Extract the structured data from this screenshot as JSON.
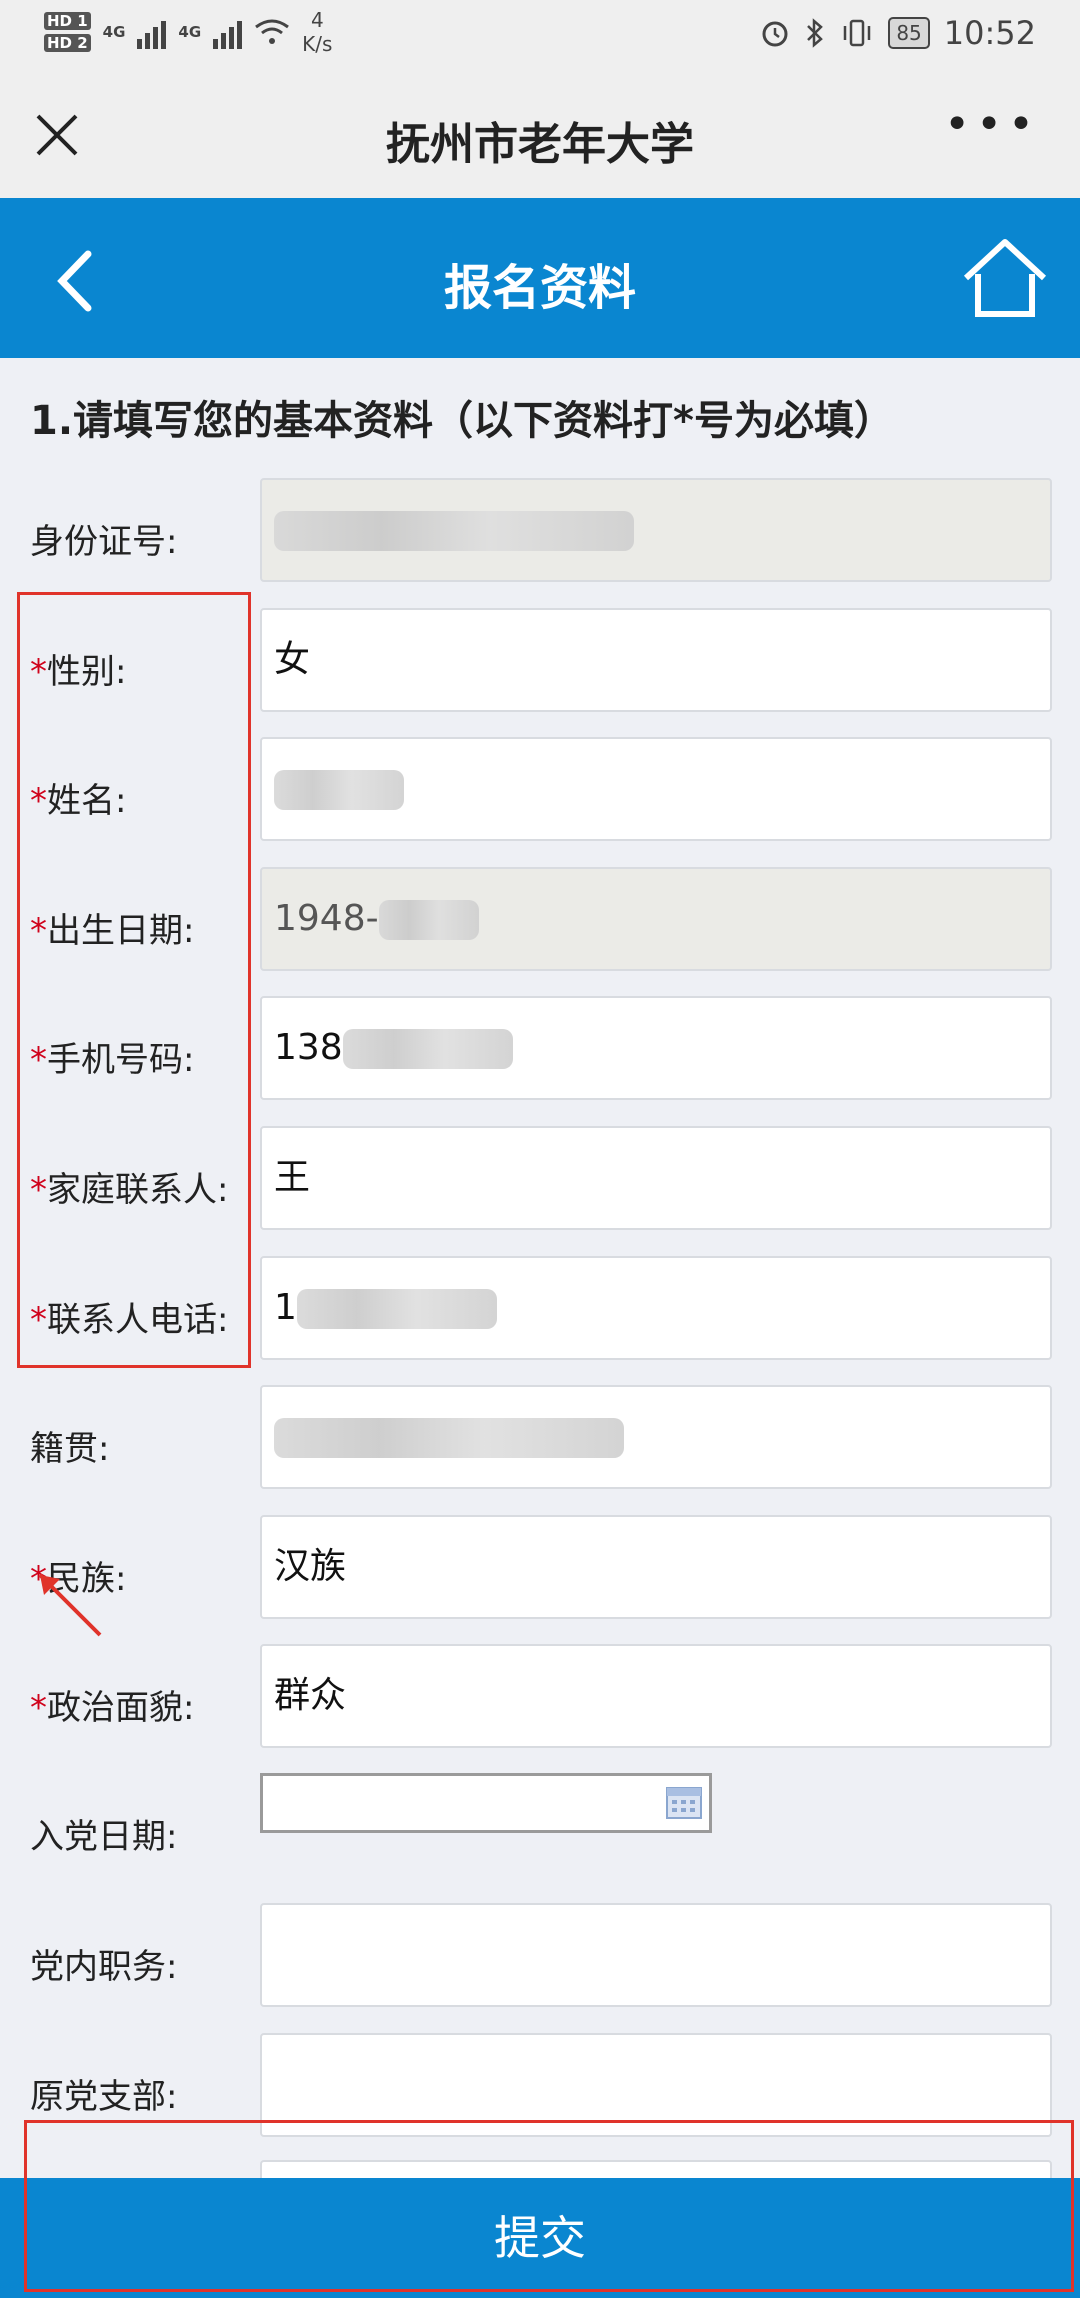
{
  "status_bar": {
    "sim1": "HD 1",
    "sim2": "HD 2",
    "net1": "4G",
    "net2": "4G",
    "speed_value": "4",
    "speed_unit": "K/s",
    "battery": "85",
    "time": "10:52"
  },
  "titlebar": {
    "title": "抚州市老年大学"
  },
  "header": {
    "title": "报名资料"
  },
  "section_title": "1.请填写您的基本资料（以下资料打*号为必填）",
  "fields": [
    {
      "label": "身份证号:",
      "required": false,
      "value": ""
    },
    {
      "label": "性别:",
      "required": true,
      "value": "女"
    },
    {
      "label": "姓名:",
      "required": true,
      "value": ""
    },
    {
      "label": "出生日期:",
      "required": true,
      "value": "1948-"
    },
    {
      "label": "手机号码:",
      "required": true,
      "value": "138"
    },
    {
      "label": "家庭联系人:",
      "required": true,
      "value": "王"
    },
    {
      "label": "联系人电话:",
      "required": true,
      "value": "1"
    },
    {
      "label": "籍贯:",
      "required": false,
      "value": ""
    },
    {
      "label": "民族:",
      "required": true,
      "value": "汉族"
    },
    {
      "label": "政治面貌:",
      "required": true,
      "value": "群众"
    },
    {
      "label": "入党日期:",
      "required": false,
      "value": ""
    },
    {
      "label": "党内职务:",
      "required": false,
      "value": ""
    },
    {
      "label": "原党支部:",
      "required": false,
      "value": ""
    }
  ],
  "required_mark": "*",
  "submit_label": "提交",
  "colors": {
    "header_blue": "#0a86d0",
    "required_red": "#d0021b",
    "annotation_red": "#e0332a"
  }
}
